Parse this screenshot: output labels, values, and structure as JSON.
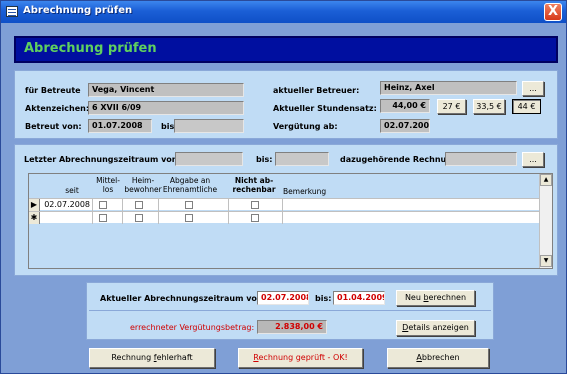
{
  "window": {
    "title": "Abrechnung prüfen",
    "close": "X"
  },
  "header": {
    "title": "Abrechung prüfen"
  },
  "info": {
    "betreute_label": "für Betreute",
    "betreute_value": "Vega, Vincent",
    "aktenzeichen_label": "Aktenzeichen:",
    "aktenzeichen_value": "6 XVII 6/09",
    "betreut_von_label": "Betreut von:",
    "betreut_von_value": "01.07.2008",
    "bis_label": "bis:",
    "bis_value": "",
    "betreuer_label": "aktueller Betreuer:",
    "betreuer_value": "Heinz, Axel",
    "betreuer_button": "...",
    "stundensatz_label": "Aktueller Stundensatz:",
    "stundensatz_value": "44,00 €",
    "rate_buttons": [
      "27 €",
      "33,5 €",
      "44 €"
    ],
    "verguetung_label": "Vergütung ab:",
    "verguetung_value": "02.07.2008"
  },
  "period": {
    "letzter_label": "Letzter Abrechnungszeitraum von:",
    "letzter_von": "",
    "bis_label": "bis:",
    "bis_value": "",
    "rechnung_label": "dazugehörende Rechnung:",
    "rechnung_value": "",
    "rechnung_button": "..."
  },
  "grid": {
    "columns": {
      "seit": "seit",
      "mittellos": "Mittel-\nlos",
      "heimbewohner": "Heim-\nbewohner",
      "abgabe": "Abgabe an\nEhrenamtliche",
      "nicht": "Nicht ab-\nrechenbar",
      "bemerkung": "Bemerkung"
    },
    "rows": [
      {
        "selector": "▶",
        "seit": "02.07.2008"
      },
      {
        "selector": "✱",
        "seit": ""
      }
    ]
  },
  "summary": {
    "zeitraum_label": "Aktueller Abrechnungszeitraum von:",
    "zeitraum_von": "02.07.2008",
    "bis_label": "bis:",
    "zeitraum_bis": "01.04.2009",
    "neu_button_prefix": "Neu ",
    "neu_button_ul": "b",
    "neu_button_suffix": "erechnen",
    "betrag_label": "errechneter Vergütungsbetrag:",
    "betrag_value": "2.838,00 €",
    "details_button_ul": "D",
    "details_button_suffix": "etails anzeigen"
  },
  "actions": {
    "fehlerhaft_prefix": "Rechnung ",
    "fehlerhaft_ul": "f",
    "fehlerhaft_suffix": "ehlerhaft",
    "ok_ul": "R",
    "ok_suffix": "echnung geprüft - OK!",
    "abbrechen_ul": "A",
    "abbrechen_suffix": "bbrechen"
  },
  "colors": {
    "accent": "#000fa0",
    "header_text": "#5fd05f",
    "alert": "#d00000"
  }
}
